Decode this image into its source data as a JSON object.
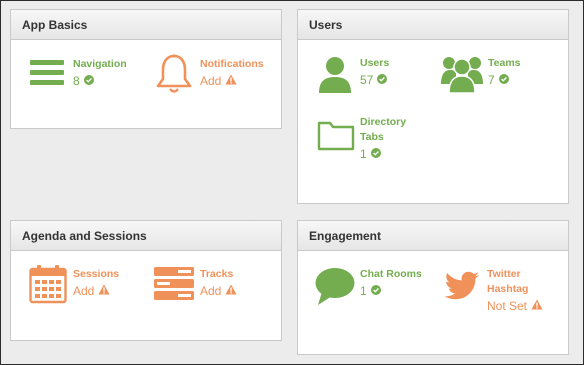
{
  "colors": {
    "green": "#73ad4f",
    "orange": "#f0915a"
  },
  "app_basics": {
    "title": "App Basics",
    "navigation": {
      "label": "Navigation",
      "value": "8",
      "icon": "hamburger-menu-icon",
      "status": "check-icon"
    },
    "notifications": {
      "label": "Notifications",
      "value": "Add",
      "icon": "bell-icon",
      "status": "warning-icon"
    }
  },
  "users": {
    "title": "Users",
    "users": {
      "label": "Users",
      "value": "57",
      "icon": "user-icon",
      "status": "check-icon"
    },
    "teams": {
      "label": "Teams",
      "value": "7",
      "icon": "team-icon",
      "status": "check-icon"
    },
    "directory_tabs": {
      "label_line1": "Directory",
      "label_line2": "Tabs",
      "value": "1",
      "icon": "folder-icon",
      "status": "check-icon"
    }
  },
  "agenda": {
    "title": "Agenda and Sessions",
    "sessions": {
      "label": "Sessions",
      "value": "Add",
      "icon": "calendar-icon",
      "status": "warning-icon"
    },
    "tracks": {
      "label": "Tracks",
      "value": "Add",
      "icon": "tracks-icon",
      "status": "warning-icon"
    }
  },
  "engagement": {
    "title": "Engagement",
    "chat_rooms": {
      "label": "Chat Rooms",
      "value": "1",
      "icon": "chat-bubble-icon",
      "status": "check-icon"
    },
    "twitter": {
      "label_line1": "Twitter",
      "label_line2": "Hashtag",
      "value": "Not Set",
      "icon": "twitter-bird-icon",
      "status": "warning-icon"
    }
  }
}
